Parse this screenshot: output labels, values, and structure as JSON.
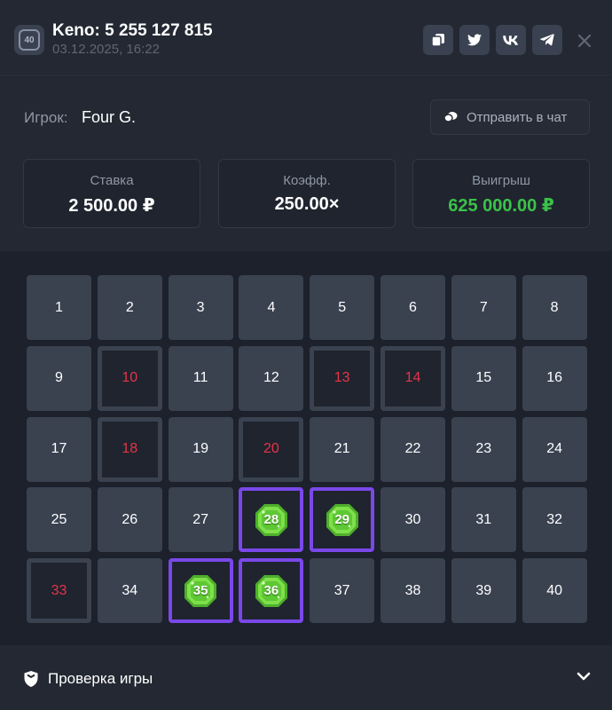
{
  "header": {
    "badge": "40",
    "title": "Keno: 5 255 127 815",
    "datetime": "03.12.2025, 16:22",
    "buttons": [
      "copy-icon",
      "twitter-icon",
      "vk-icon",
      "telegram-icon"
    ],
    "close": "close-icon"
  },
  "player": {
    "label": "Игрок:",
    "name": "Four G.",
    "chat_button": "Отправить в чат"
  },
  "stats": {
    "bet_label": "Ставка",
    "bet_value": "2 500.00 ₽",
    "coef_label": "Коэфф.",
    "coef_value": "250.00×",
    "win_label": "Выигрыш",
    "win_value": "625 000.00 ₽"
  },
  "board": {
    "numbers": [
      1,
      2,
      3,
      4,
      5,
      6,
      7,
      8,
      9,
      10,
      11,
      12,
      13,
      14,
      15,
      16,
      17,
      18,
      19,
      20,
      21,
      22,
      23,
      24,
      25,
      26,
      27,
      28,
      29,
      30,
      31,
      32,
      33,
      34,
      35,
      36,
      37,
      38,
      39,
      40
    ],
    "miss": [
      10,
      13,
      14,
      18,
      20,
      33
    ],
    "hit": [
      28,
      29,
      35,
      36
    ]
  },
  "footer": {
    "label": "Проверка игры"
  },
  "colors": {
    "accent_win": "#3bc24a",
    "miss": "#e8334a",
    "hit_border": "#7a48e8",
    "gem": "#6fd23a"
  }
}
